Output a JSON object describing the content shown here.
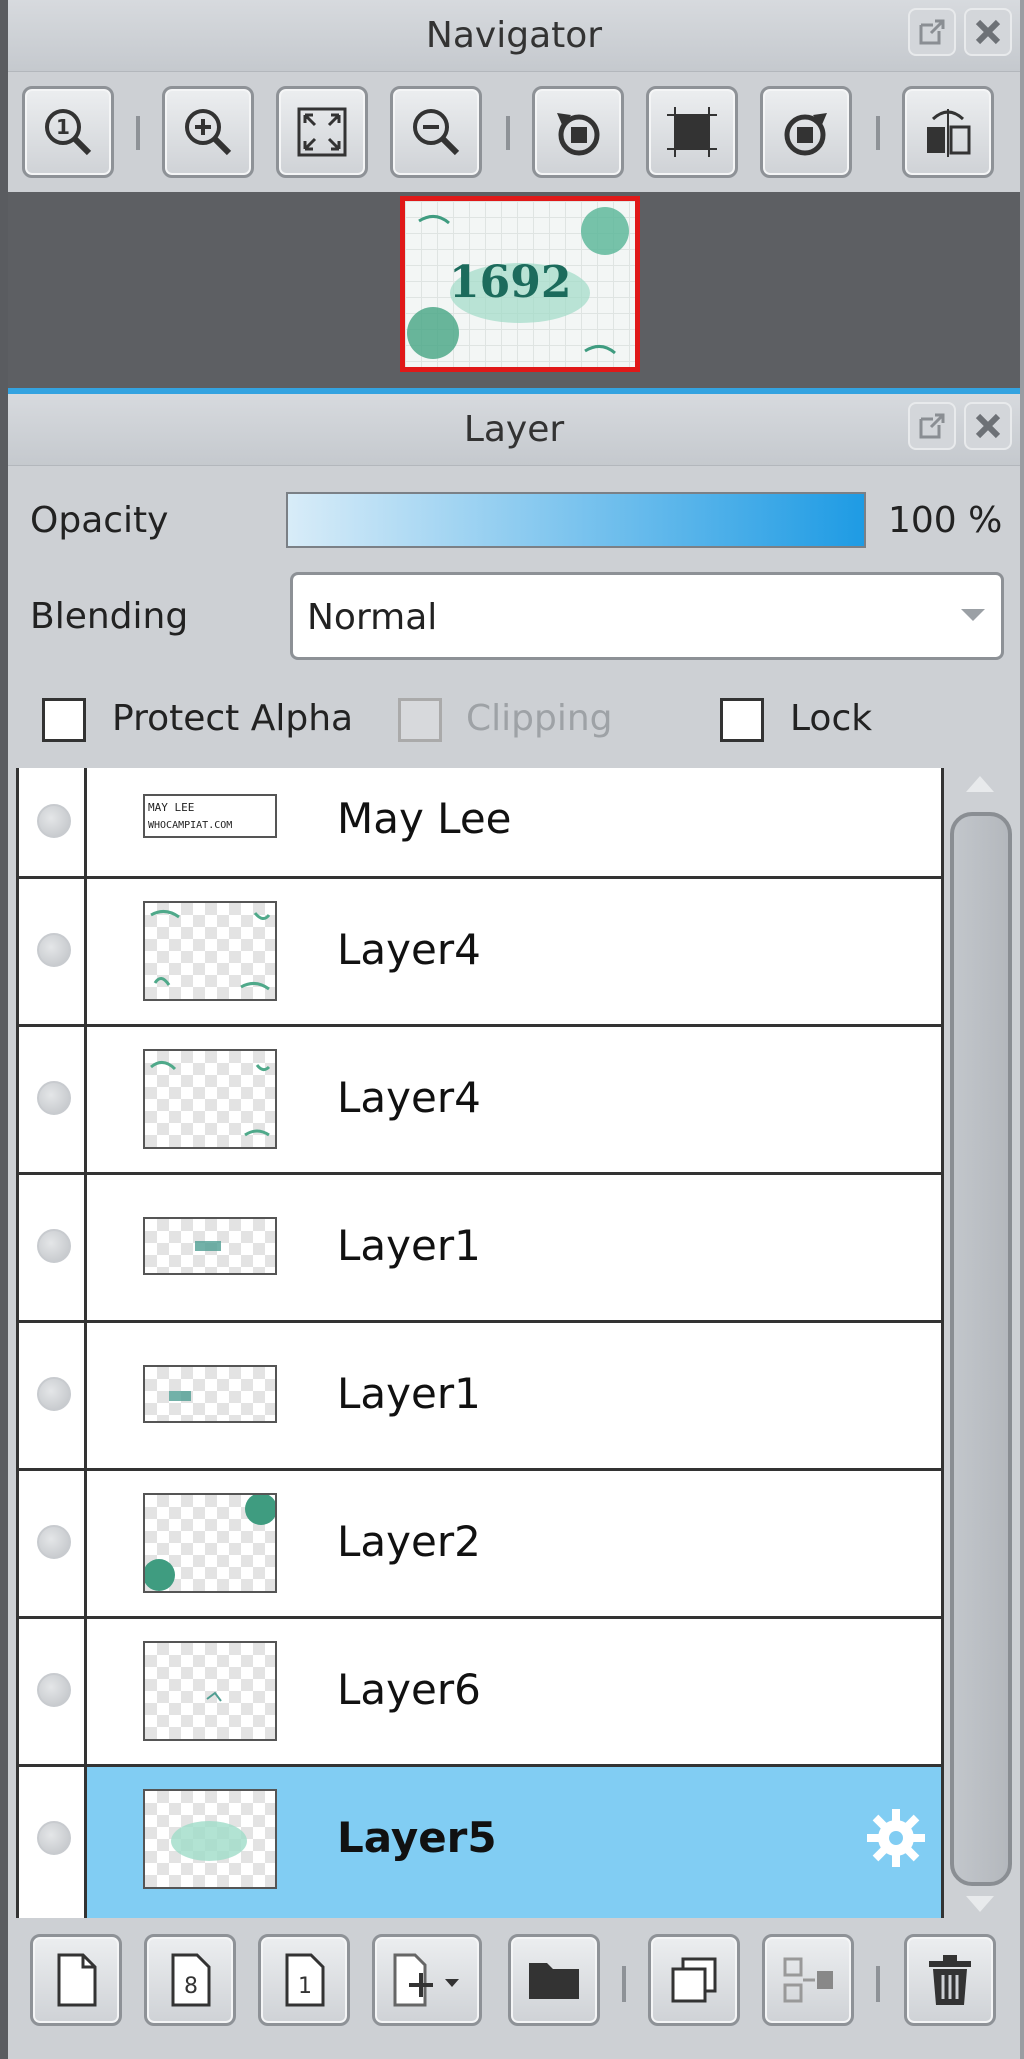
{
  "navigator": {
    "title": "Navigator",
    "tools": [
      {
        "icon": "zoom-actual-icon",
        "name": "zoom-actual-button"
      },
      {
        "icon": "zoom-in-icon",
        "name": "zoom-in-button"
      },
      {
        "icon": "fit-screen-icon",
        "name": "fit-screen-button"
      },
      {
        "icon": "zoom-out-icon",
        "name": "zoom-out-button"
      },
      {
        "icon": "rotate-left-icon",
        "name": "rotate-left-button"
      },
      {
        "icon": "reset-view-icon",
        "name": "reset-view-button"
      },
      {
        "icon": "rotate-right-icon",
        "name": "rotate-right-button"
      },
      {
        "icon": "flip-horizontal-icon",
        "name": "flip-horizontal-button"
      }
    ],
    "preview_text": "1692"
  },
  "layer_panel": {
    "title": "Layer",
    "opacity_label": "Opacity",
    "opacity_value": "100 %",
    "opacity_fraction": 1.0,
    "blending_label": "Blending",
    "blending_value": "Normal",
    "protect_alpha_label": "Protect Alpha",
    "clipping_label": "Clipping",
    "lock_label": "Lock",
    "layers": [
      {
        "name": "May Lee",
        "selected": false,
        "thumb_text": "MAY LEE WHOCAMPIAT.COM"
      },
      {
        "name": "Layer4",
        "selected": false
      },
      {
        "name": "Layer4",
        "selected": false
      },
      {
        "name": "Layer1",
        "selected": false
      },
      {
        "name": "Layer1",
        "selected": false
      },
      {
        "name": "Layer2",
        "selected": false
      },
      {
        "name": "Layer6",
        "selected": false
      },
      {
        "name": "Layer5",
        "selected": true
      }
    ],
    "bottom_tools": [
      {
        "icon": "new-layer-icon",
        "name": "new-layer-button"
      },
      {
        "icon": "new-8bit-layer-icon",
        "name": "new-8bit-layer-button"
      },
      {
        "icon": "new-1bit-layer-icon",
        "name": "new-1bit-layer-button"
      },
      {
        "icon": "add-layer-menu-icon",
        "name": "add-layer-menu-button"
      },
      {
        "icon": "folder-icon",
        "name": "new-folder-button"
      },
      {
        "icon": "duplicate-layer-icon",
        "name": "duplicate-layer-button"
      },
      {
        "icon": "merge-down-icon",
        "name": "merge-down-button"
      },
      {
        "icon": "trash-icon",
        "name": "delete-layer-button"
      }
    ]
  },
  "colors": {
    "accent": "#34a3e0",
    "selected_row": "#81cdf3",
    "preview_border": "#e01818"
  }
}
